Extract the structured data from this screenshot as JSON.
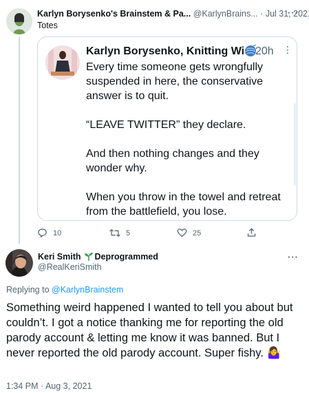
{
  "tweet1": {
    "author_name": "Karlyn Borysenko's Brainstem & Pa...",
    "handle": "@KarlynBrains...",
    "sep": "·",
    "date": "Jul 31, 2021",
    "text": "Totes",
    "menu": "···"
  },
  "quoted": {
    "author_name": "Karlyn Borysenko, Knitting Wit...",
    "time": "20h",
    "menu": "⋮",
    "paragraphs": [
      "Every time someone gets wrongfully suspended in here, the conservative answer is to quit.",
      "“LEAVE TWITTER” they declare.",
      "And then nothing changes and they wonder why.",
      "When you throw in the towel and retreat from the battlefield, you lose."
    ]
  },
  "actions": {
    "replies": "10",
    "retweets": "5",
    "likes": "25"
  },
  "tweet2": {
    "author_name": "Keri Smith",
    "badge": "Deprogrammed",
    "handle": "@RealKeriSmith",
    "menu": "···",
    "replying_prefix": "Replying to ",
    "replying_to": "@KarlynBrainstem",
    "text": "Something weird happened I wanted to tell you about but couldn’t. I got a notice thanking me for reporting the old parody account & letting me know it was banned. But I never reported the old parody account. Super fishy. ",
    "emoji": "🤷‍♀️",
    "timestamp": "1:34 PM · Aug 3, 2021"
  },
  "colors": {
    "accent": "#1d9bf0",
    "muted": "#536471",
    "border": "#cfd9de",
    "sprout": "#2ea44f"
  }
}
